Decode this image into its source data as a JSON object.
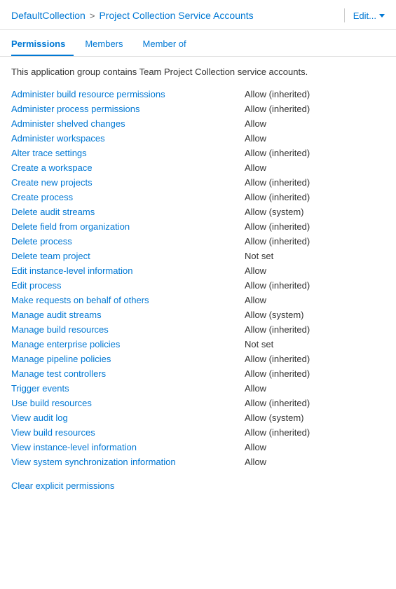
{
  "header": {
    "breadcrumb_default": "DefaultCollection",
    "breadcrumb_separator": ">",
    "breadcrumb_current": "Project Collection Service Accounts",
    "edit_label": "Edit...",
    "divider": true
  },
  "tabs": [
    {
      "label": "Permissions",
      "active": true
    },
    {
      "label": "Members",
      "active": false
    },
    {
      "label": "Member of",
      "active": false
    }
  ],
  "description": "This application group contains Team Project Collection service accounts.",
  "permissions": [
    {
      "name": "Administer build resource permissions",
      "value": "Allow (inherited)"
    },
    {
      "name": "Administer process permissions",
      "value": "Allow (inherited)"
    },
    {
      "name": "Administer shelved changes",
      "value": "Allow"
    },
    {
      "name": "Administer workspaces",
      "value": "Allow"
    },
    {
      "name": "Alter trace settings",
      "value": "Allow (inherited)"
    },
    {
      "name": "Create a workspace",
      "value": "Allow"
    },
    {
      "name": "Create new projects",
      "value": "Allow (inherited)"
    },
    {
      "name": "Create process",
      "value": "Allow (inherited)"
    },
    {
      "name": "Delete audit streams",
      "value": "Allow (system)"
    },
    {
      "name": "Delete field from organization",
      "value": "Allow (inherited)"
    },
    {
      "name": "Delete process",
      "value": "Allow (inherited)"
    },
    {
      "name": "Delete team project",
      "value": "Not set"
    },
    {
      "name": "Edit instance-level information",
      "value": "Allow"
    },
    {
      "name": "Edit process",
      "value": "Allow (inherited)"
    },
    {
      "name": "Make requests on behalf of others",
      "value": "Allow"
    },
    {
      "name": "Manage audit streams",
      "value": "Allow (system)"
    },
    {
      "name": "Manage build resources",
      "value": "Allow (inherited)"
    },
    {
      "name": "Manage enterprise policies",
      "value": "Not set"
    },
    {
      "name": "Manage pipeline policies",
      "value": "Allow (inherited)"
    },
    {
      "name": "Manage test controllers",
      "value": "Allow (inherited)"
    },
    {
      "name": "Trigger events",
      "value": "Allow"
    },
    {
      "name": "Use build resources",
      "value": "Allow (inherited)"
    },
    {
      "name": "View audit log",
      "value": "Allow (system)"
    },
    {
      "name": "View build resources",
      "value": "Allow (inherited)"
    },
    {
      "name": "View instance-level information",
      "value": "Allow"
    },
    {
      "name": "View system synchronization information",
      "value": "Allow"
    }
  ],
  "clear_link": "Clear explicit permissions"
}
